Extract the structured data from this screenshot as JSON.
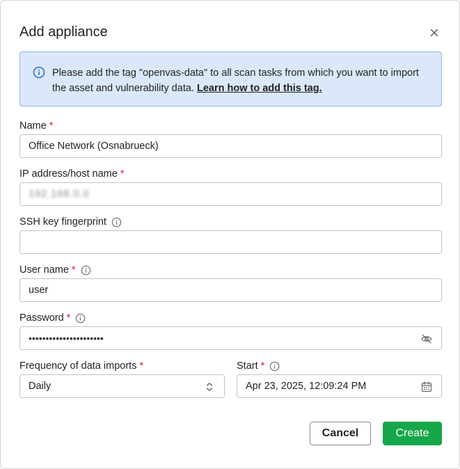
{
  "dialog": {
    "title": "Add appliance",
    "close_label": "×"
  },
  "notice": {
    "text": "Please add the tag \"openvas-data\" to all scan tasks from which you want to import the asset and vulnerability data.",
    "link": "Learn how to add this tag."
  },
  "fields": {
    "name": {
      "label": "Name",
      "required": "*",
      "value": "Office Network (Osnabrueck)"
    },
    "host": {
      "label": "IP address/host name",
      "required": "*",
      "value": "192.168.0.0"
    },
    "ssh": {
      "label": "SSH key fingerprint",
      "value": ""
    },
    "user": {
      "label": "User name",
      "required": "*",
      "value": "user"
    },
    "password": {
      "label": "Password",
      "required": "*",
      "value": "••••••••••••••••••••••"
    },
    "frequency": {
      "label": "Frequency of data imports",
      "required": "*",
      "value": "Daily"
    },
    "start": {
      "label": "Start",
      "required": "*",
      "value": "Apr 23, 2025, 12:09:24 PM"
    }
  },
  "buttons": {
    "cancel": "Cancel",
    "create": "Create"
  },
  "colors": {
    "primary": "#15a74a",
    "required": "#d8232a",
    "notice_bg": "#dbe8fb",
    "notice_border": "#8db2e9",
    "notice_icon": "#2f6fd6"
  },
  "icons": {
    "close": "close-icon",
    "info": "info-circle-icon",
    "hint": "info-outline-icon",
    "eye": "eye-off-icon",
    "select": "chevron-up-down-icon",
    "calendar": "calendar-icon"
  }
}
